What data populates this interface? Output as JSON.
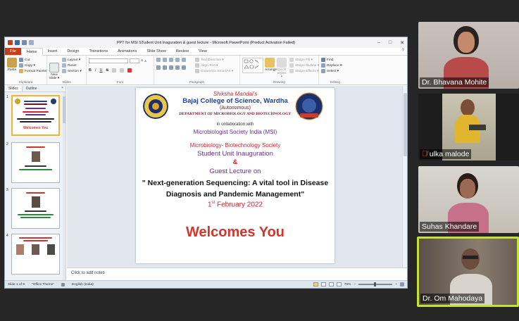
{
  "window": {
    "title": "PPT for MSI STudent Unit Inaguration & guest lecture - Microsoft PowerPoint (Product Activation Failed)",
    "controls": [
      "–",
      "□",
      "✕"
    ]
  },
  "ribbon_tabs": [
    "File",
    "Home",
    "Insert",
    "Design",
    "Transitions",
    "Animations",
    "Slide Show",
    "Review",
    "View"
  ],
  "active_tab": "Home",
  "ribbon": {
    "clipboard": {
      "paste": "Paste",
      "cut": "Cut",
      "copy": "Copy ▾",
      "format_painter": "Format Painter",
      "label": "Clipboard"
    },
    "slides": {
      "new_slide": "New Slide ▾",
      "layout": "Layout ▾",
      "reset": "Reset",
      "section": "Section ▾",
      "label": "Slides"
    },
    "font": {
      "label": "Font",
      "bold": "B",
      "italic": "I",
      "underline": "U",
      "strike": "S",
      "size_up": "A",
      "size_down": "A"
    },
    "paragraph": {
      "text_direction": "Text Direction ▾",
      "align_text": "Align Text ▾",
      "convert_smartart": "Convert to SmartArt ▾",
      "label": "Paragraph"
    },
    "drawing": {
      "arrange": "Arrange",
      "quick_styles": "Quick Styles ▾",
      "shape_fill": "Shape Fill ▾",
      "shape_outline": "Shape Outline ▾",
      "shape_effects": "Shape Effects ▾",
      "label": "Drawing"
    },
    "editing": {
      "find": "Find",
      "replace": "Replace ▾",
      "select": "Select ▾",
      "label": "Editing"
    }
  },
  "left_pane": {
    "tabs": [
      "Slides",
      "Outline"
    ],
    "close": "×",
    "slide_numbers": [
      "1",
      "2",
      "3",
      "4"
    ],
    "slide1_welcome": "Welcomes You"
  },
  "slide": {
    "org": "Shiksha Mandal's",
    "college": "Bajaj College of Science, Wardha",
    "autonomous": "(Autonomous)",
    "department": "DEPARTMENT OF MICROBIOLOGY AND BIOTECHNOLOGY",
    "collab": "in collaboration with",
    "msi": "Microbiologist Society India (MSI)",
    "society": "Microbiology- Biotechnology Society",
    "unit": "Student Unit Inauguration",
    "amp": "&",
    "guest": "Guest Lecture on",
    "topic_line1": "\" Next-generation Sequencing: A vital tool in Disease",
    "topic_line2": "Diagnosis and Pandemic Management\"",
    "date_day": "1",
    "date_sup": "st",
    "date_rest": " February 2022",
    "welcome": "Welcomes You"
  },
  "notes_placeholder": "Click to add notes",
  "status": {
    "slide_of": "Slide 1 of 9",
    "theme": "\"Office Theme\"",
    "language": "English (India)",
    "zoom": "79%"
  },
  "participants": [
    {
      "name": "Dr. Bhavana Mohite",
      "muted": false
    },
    {
      "name": "ulka malode",
      "muted": true
    },
    {
      "name": "Suhas Khandare",
      "muted": false
    },
    {
      "name": "Dr. Om Mahodaya",
      "muted": false,
      "speaking": true
    }
  ],
  "colors": {
    "file_tab": "#c43e1c",
    "college_blue": "#1d3fa6",
    "maroon": "#7a1022",
    "society_red": "#d2222d",
    "msi_purple": "#6a2c8f",
    "welcome_red": "#d8342a",
    "speaking_border": "#c6e03a"
  }
}
